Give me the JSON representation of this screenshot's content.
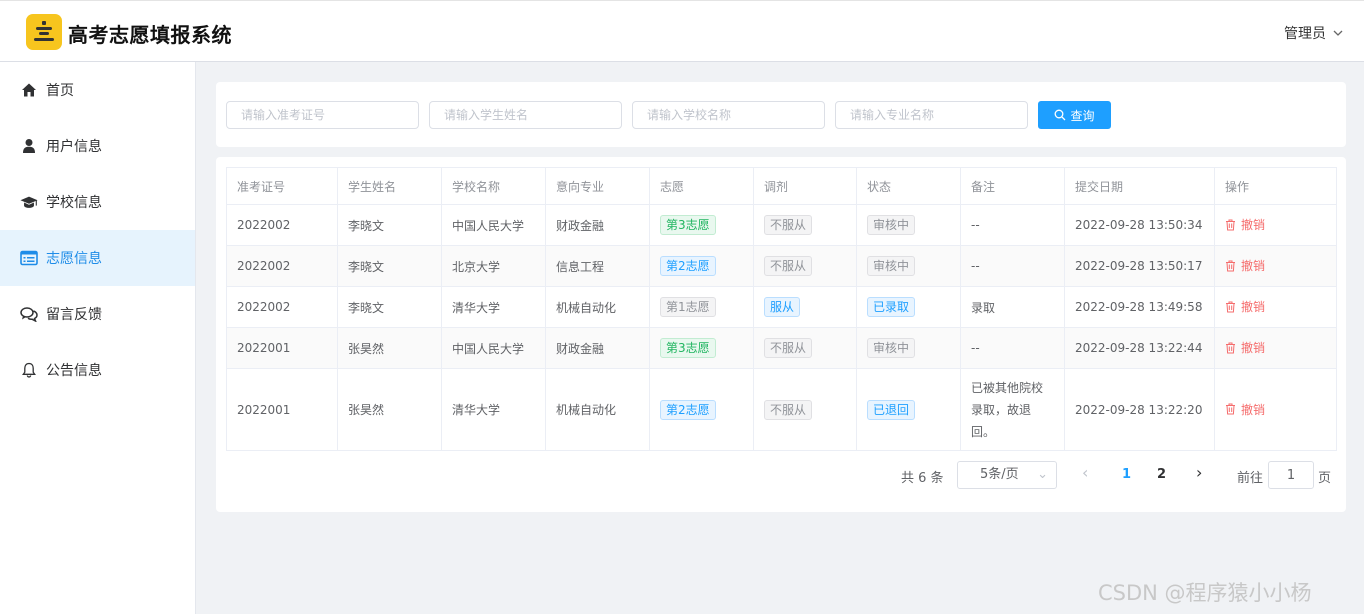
{
  "app": {
    "title": "高考志愿填报系统",
    "user": "管理员"
  },
  "sidebar": {
    "items": [
      {
        "label": "首页",
        "icon": "home-icon",
        "active": false
      },
      {
        "label": "用户信息",
        "icon": "user-icon",
        "active": false
      },
      {
        "label": "学校信息",
        "icon": "graduation-cap-icon",
        "active": false
      },
      {
        "label": "志愿信息",
        "icon": "list-card-icon",
        "active": true
      },
      {
        "label": "留言反馈",
        "icon": "chat-bubbles-icon",
        "active": false
      },
      {
        "label": "公告信息",
        "icon": "bell-icon",
        "active": false
      }
    ]
  },
  "search": {
    "exam_id_placeholder": "请输入准考证号",
    "name_placeholder": "请输入学生姓名",
    "school_placeholder": "请输入学校名称",
    "major_placeholder": "请输入专业名称",
    "button_label": "查询"
  },
  "table": {
    "headers": [
      "准考证号",
      "学生姓名",
      "学校名称",
      "意向专业",
      "志愿",
      "调剂",
      "状态",
      "备注",
      "提交日期",
      "操作"
    ],
    "rows": [
      {
        "exam_id": "2022002",
        "name": "李晓文",
        "school": "中国人民大学",
        "major": "财政金融",
        "choice": "第3志愿",
        "choice_color": "green",
        "adjust": "不服从",
        "adjust_color": "gray",
        "status": "审核中",
        "status_color": "gray",
        "note": "--",
        "date": "2022-09-28 13:50:34",
        "action": "撤销"
      },
      {
        "exam_id": "2022002",
        "name": "李晓文",
        "school": "北京大学",
        "major": "信息工程",
        "choice": "第2志愿",
        "choice_color": "blue",
        "adjust": "不服从",
        "adjust_color": "gray",
        "status": "审核中",
        "status_color": "gray",
        "note": "--",
        "date": "2022-09-28 13:50:17",
        "action": "撤销"
      },
      {
        "exam_id": "2022002",
        "name": "李晓文",
        "school": "清华大学",
        "major": "机械自动化",
        "choice": "第1志愿",
        "choice_color": "gray",
        "adjust": "服从",
        "adjust_color": "blue",
        "status": "已录取",
        "status_color": "blue",
        "note": "录取",
        "date": "2022-09-28 13:49:58",
        "action": "撤销"
      },
      {
        "exam_id": "2022001",
        "name": "张昊然",
        "school": "中国人民大学",
        "major": "财政金融",
        "choice": "第3志愿",
        "choice_color": "green",
        "adjust": "不服从",
        "adjust_color": "gray",
        "status": "审核中",
        "status_color": "gray",
        "note": "--",
        "date": "2022-09-28 13:22:44",
        "action": "撤销"
      },
      {
        "exam_id": "2022001",
        "name": "张昊然",
        "school": "清华大学",
        "major": "机械自动化",
        "choice": "第2志愿",
        "choice_color": "blue",
        "adjust": "不服从",
        "adjust_color": "gray",
        "status": "已退回",
        "status_color": "blue",
        "note": "已被其他院校录取，故退回。",
        "date": "2022-09-28 13:22:20",
        "action": "撤销"
      }
    ]
  },
  "pagination": {
    "total": "共 6 条",
    "page_size": "5条/页",
    "prev": "‹",
    "pages": [
      "1",
      "2"
    ],
    "current": "1",
    "next": "›",
    "goto_label": "前往",
    "goto_value": "1",
    "page_suffix": "页"
  },
  "colors": {
    "primary": "#1e9fff",
    "danger": "#f56c6c",
    "success": "#20b560",
    "logo": "#f7c51e"
  },
  "watermark": "CSDN @程序猿小小杨"
}
